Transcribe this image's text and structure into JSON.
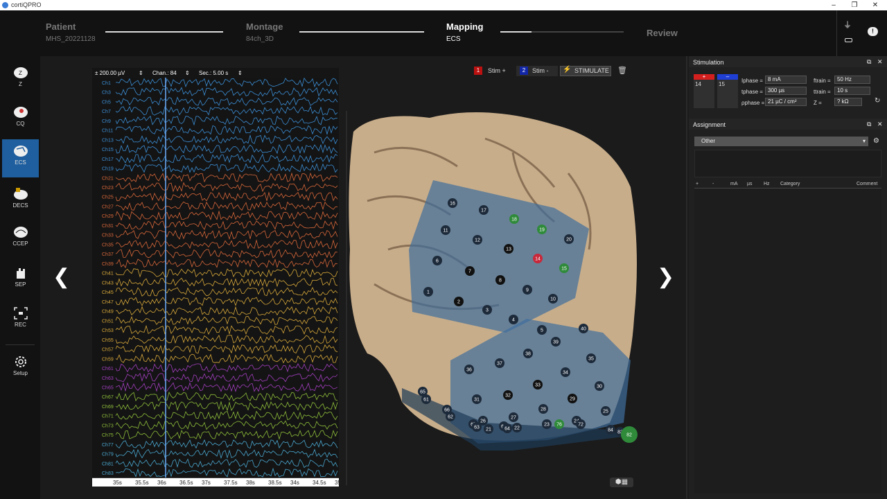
{
  "app": {
    "title": "cortiQPRO",
    "win": {
      "min": "–",
      "max": "❐",
      "close": "✕"
    }
  },
  "steps": [
    {
      "label": "Patient",
      "value": "MHS_20221128",
      "progress": 1.0
    },
    {
      "label": "Montage",
      "value": "84ch_3D",
      "progress": 1.0
    },
    {
      "label": "Mapping",
      "value": "ECS",
      "progress": 0.25
    },
    {
      "label": "Review",
      "value": ""
    }
  ],
  "tools": [
    {
      "label": "Z",
      "icon": "head-z-icon"
    },
    {
      "label": "CQ",
      "icon": "head-cq-icon"
    },
    {
      "label": "ECS",
      "icon": "head-ecs-icon"
    },
    {
      "label": "DECS",
      "icon": "head-decs-icon"
    },
    {
      "label": "CCEP",
      "icon": "head-ccep-icon"
    },
    {
      "label": "SEP",
      "icon": "hand-sep-icon"
    },
    {
      "label": "REC",
      "icon": "rec-icon"
    },
    {
      "label": "Setup",
      "icon": "gear-icon"
    }
  ],
  "eeg": {
    "amplitude": "± 200.00 µV",
    "chan": "Chan.: 84",
    "sec": "Sec.: 5.00 s",
    "channels": [
      "Ch1",
      "Ch3",
      "Ch5",
      "Ch7",
      "Ch9",
      "Ch11",
      "Ch13",
      "Ch15",
      "Ch17",
      "Ch19",
      "Ch21",
      "Ch23",
      "Ch25",
      "Ch27",
      "Ch29",
      "Ch31",
      "Ch33",
      "Ch35",
      "Ch37",
      "Ch39",
      "Ch41",
      "Ch43",
      "Ch45",
      "Ch47",
      "Ch49",
      "Ch51",
      "Ch53",
      "Ch55",
      "Ch57",
      "Ch59",
      "Ch61",
      "Ch63",
      "Ch65",
      "Ch67",
      "Ch69",
      "Ch71",
      "Ch73",
      "Ch75",
      "Ch77",
      "Ch79",
      "Ch81",
      "Ch83"
    ],
    "times": [
      "35s",
      "35.5s",
      "36s",
      "36.5s",
      "37s",
      "37.5s",
      "38s",
      "38.5s",
      "34s",
      "34.5s",
      "35"
    ]
  },
  "stim": {
    "plus_label": "Stim +",
    "plus_num": "1",
    "minus_label": "Stim -",
    "minus_num": "2",
    "stimulate": "STIMULATE",
    "plus_electrode": "14",
    "minus_electrode": "15",
    "i_label": "Iphase =",
    "i_val": "8 mA",
    "t_label": "tphase =",
    "t_val": "300 µs",
    "rho_label": "ρphase =",
    "rho_val": "21 µC / cm²",
    "f_label": "ftrain =",
    "f_val": "50 Hz",
    "tt_label": "ttrain =",
    "tt_val": "10 s",
    "z_label": "Z =",
    "z_val": "? kΩ"
  },
  "panels": {
    "stimulation": "Stimulation",
    "assignment": "Assignment"
  },
  "assignment": {
    "category": "Other",
    "cols": [
      "+",
      "-",
      "mA",
      "µs",
      "Hz",
      "Category",
      "Comment"
    ]
  },
  "electrodes": [
    {
      "n": "16",
      "c": "dark"
    },
    {
      "n": "17",
      "c": "dark"
    },
    {
      "n": "18",
      "c": "green"
    },
    {
      "n": "19",
      "c": "green"
    },
    {
      "n": "20",
      "c": "dark"
    },
    {
      "n": "11",
      "c": "dark"
    },
    {
      "n": "12",
      "c": "dark"
    },
    {
      "n": "13",
      "c": "black"
    },
    {
      "n": "14",
      "c": "red"
    },
    {
      "n": "15",
      "c": "green"
    },
    {
      "n": "6",
      "c": "dark"
    },
    {
      "n": "7",
      "c": "black"
    },
    {
      "n": "8",
      "c": "black"
    },
    {
      "n": "9",
      "c": "dark"
    },
    {
      "n": "10",
      "c": "dark"
    },
    {
      "n": "1",
      "c": "dark"
    },
    {
      "n": "2",
      "c": "black"
    },
    {
      "n": "3",
      "c": "dark"
    },
    {
      "n": "4",
      "c": "dark"
    },
    {
      "n": "5",
      "c": "dark"
    },
    {
      "n": "40",
      "c": "dark"
    },
    {
      "n": "39",
      "c": "dark"
    },
    {
      "n": "38",
      "c": "dark"
    },
    {
      "n": "37",
      "c": "dark"
    },
    {
      "n": "36",
      "c": "dark"
    },
    {
      "n": "35",
      "c": "dark"
    },
    {
      "n": "34",
      "c": "dark"
    },
    {
      "n": "33",
      "c": "black"
    },
    {
      "n": "32",
      "c": "black"
    },
    {
      "n": "31",
      "c": "dark"
    },
    {
      "n": "30",
      "c": "dark"
    },
    {
      "n": "29",
      "c": "black"
    },
    {
      "n": "28",
      "c": "dark"
    },
    {
      "n": "27",
      "c": "dark"
    },
    {
      "n": "26",
      "c": "dark"
    },
    {
      "n": "25",
      "c": "dark"
    },
    {
      "n": "24",
      "c": "dark"
    },
    {
      "n": "23",
      "c": "dark"
    },
    {
      "n": "22",
      "c": "dark"
    },
    {
      "n": "21",
      "c": "dark"
    },
    {
      "n": "76",
      "c": "green"
    },
    {
      "n": "72",
      "c": "dark"
    },
    {
      "n": "84",
      "c": "dark"
    },
    {
      "n": "83",
      "c": "dark"
    },
    {
      "n": "82",
      "c": "green"
    },
    {
      "n": "65",
      "c": "dark"
    },
    {
      "n": "61",
      "c": "dark"
    },
    {
      "n": "66",
      "c": "dark"
    },
    {
      "n": "62",
      "c": "dark"
    },
    {
      "n": "67",
      "c": "dark"
    },
    {
      "n": "63",
      "c": "dark"
    },
    {
      "n": "68",
      "c": "dark"
    },
    {
      "n": "64",
      "c": "dark"
    }
  ],
  "colors": {
    "plus": "#d41f1f",
    "minus": "#1f3fd4",
    "active": "#1f5f9f",
    "grid": "#5b7aa0"
  }
}
